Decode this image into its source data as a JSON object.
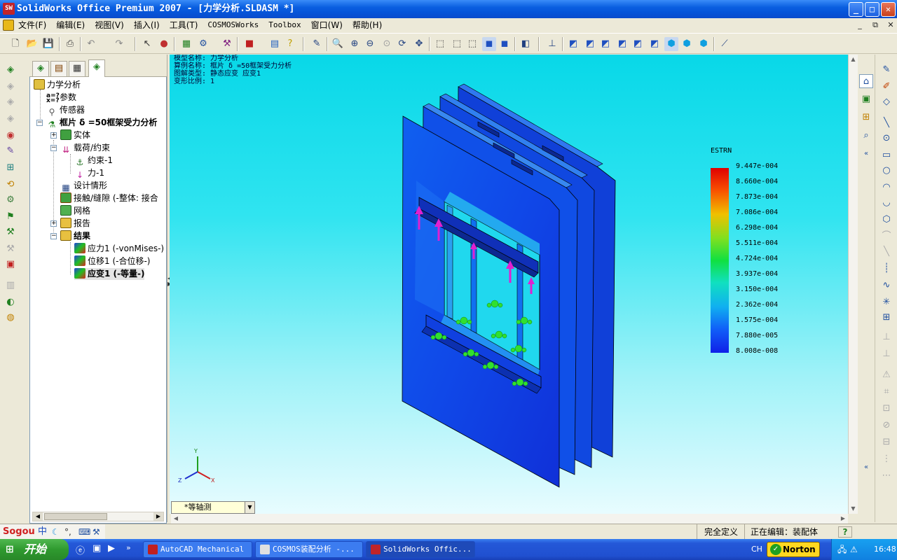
{
  "window": {
    "title": "SolidWorks Office Premium 2007 - [力学分析.SLDASM *]",
    "logo_text": "SW"
  },
  "menu": {
    "items": [
      {
        "label": "文件(F)"
      },
      {
        "label": "编辑(E)"
      },
      {
        "label": "视图(V)"
      },
      {
        "label": "插入(I)"
      },
      {
        "label": "工具(T)"
      },
      {
        "label": "COSMOSWorks"
      },
      {
        "label": "Toolbox"
      },
      {
        "label": "窗口(W)"
      },
      {
        "label": "帮助(H)"
      }
    ]
  },
  "tree": {
    "root": "力学分析",
    "params": "参数",
    "sensors": "传感器",
    "study": "框片 δ =50框架受力分析",
    "solids": "实体",
    "loads": "载荷/约束",
    "fixture": "约束-1",
    "force": "力-1",
    "design_scenario": "设计情形",
    "contact": "接触/缝隙 (-整体: 接合",
    "mesh": "网格",
    "report": "报告",
    "results": "结果",
    "stress": "应力1 (-vonMises-)",
    "displacement": "位移1 (-合位移-)",
    "strain": "应变1 (-等量-)"
  },
  "info": {
    "line1": "模型名称: 力学分析",
    "line2": "算例名称: 框片 δ =50框架受力分析",
    "line3": "图解类型: 静态应变 应变1",
    "line4": "变形比例: 1"
  },
  "legend": {
    "title": "ESTRN",
    "values": [
      "9.447e-004",
      "8.660e-004",
      "7.873e-004",
      "7.086e-004",
      "6.298e-004",
      "5.511e-004",
      "4.724e-004",
      "3.937e-004",
      "3.150e-004",
      "2.362e-004",
      "1.575e-004",
      "7.880e-005",
      "8.008e-008"
    ]
  },
  "triad": {
    "x": "X",
    "y": "Y",
    "z": "Z"
  },
  "view_selector": {
    "value": "*等轴测"
  },
  "status": {
    "defined": "完全定义",
    "editing": "正在编辑：装配体",
    "help": "?"
  },
  "ime": {
    "brand": "Sogou",
    "mode": "中"
  },
  "taskbar": {
    "start": "开始",
    "tasks": [
      {
        "label": "AutoCAD Mechanical"
      },
      {
        "label": "COSMOS装配分析 -..."
      },
      {
        "label": "SolidWorks Offic..."
      }
    ],
    "lang": "CH",
    "norton": "Norton",
    "clock": "16:48"
  }
}
